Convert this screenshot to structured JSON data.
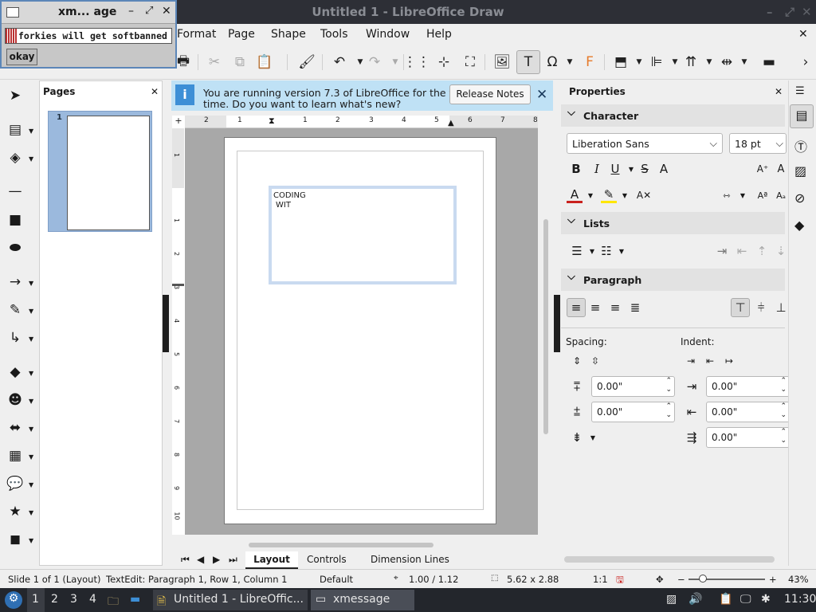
{
  "window": {
    "title": "Untitled 1 - LibreOffice Draw"
  },
  "menu": [
    "Format",
    "Page",
    "Shape",
    "Tools",
    "Window",
    "Help"
  ],
  "infobar": {
    "line1": "You are running version 7.3 of LibreOffice for the first",
    "line2": "time. Do you want to learn what's new?",
    "button": "Release Notes"
  },
  "pages_panel": {
    "title": "Pages",
    "page_number": "1"
  },
  "ruler": {
    "h_ticks": [
      "2",
      "1",
      "1",
      "2",
      "3",
      "4",
      "5",
      "6",
      "7",
      "8"
    ],
    "v_ticks": [
      "1",
      "1",
      "2",
      "3",
      "4",
      "5",
      "6",
      "7",
      "8",
      "9",
      "10"
    ]
  },
  "document": {
    "text_line1": "CODING",
    "text_line2": "WIT"
  },
  "bottom_tabs": [
    "Layout",
    "Controls",
    "Dimension Lines"
  ],
  "properties": {
    "title": "Properties",
    "character": {
      "title": "Character",
      "font": "Liberation Sans",
      "size": "18 pt"
    },
    "lists": {
      "title": "Lists"
    },
    "paragraph": {
      "title": "Paragraph",
      "spacing_label": "Spacing:",
      "indent_label": "Indent:",
      "above": "0.00\"",
      "below": "0.00\"",
      "before_text": "0.00\"",
      "after_text": "0.00\"",
      "first_line": "0.00\""
    }
  },
  "status": {
    "slide": "Slide 1 of 1 (Layout)",
    "edit": "TextEdit: Paragraph 1, Row 1, Column 1",
    "layout": "Default",
    "position": "1.00 / 1.12",
    "size": "5.62 x 2.88",
    "ratio": "1:1",
    "zoom": "43%"
  },
  "taskbar": {
    "workspaces": [
      "1",
      "2",
      "3",
      "4"
    ],
    "task1": "Untitled 1 - LibreOffic...",
    "task2": "xmessage",
    "clock": "11:30"
  },
  "xmessage": {
    "title": "xm... age",
    "message": "forkies will get softbanned",
    "button": "okay"
  },
  "colors": {
    "accent": "#3d8fd6",
    "infobar": "#bfe1f5",
    "taskbar": "#23262c"
  }
}
